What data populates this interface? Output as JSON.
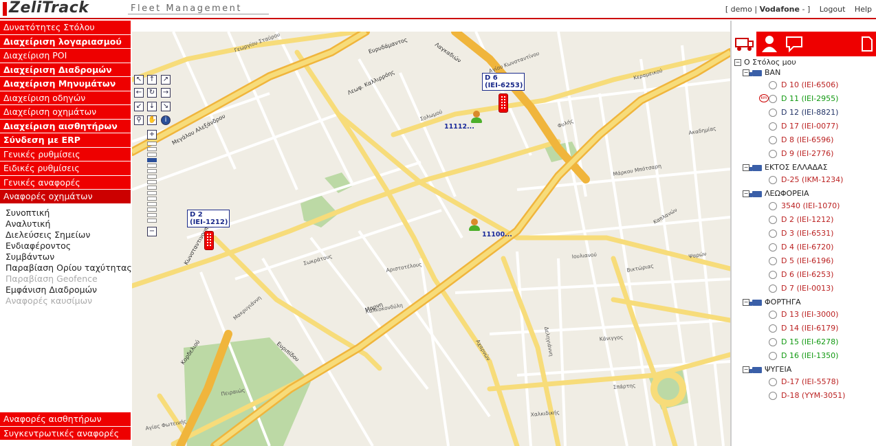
{
  "header": {
    "logo": "ZeliTrack",
    "subtitle": "Fleet Management",
    "user_box": "[ demo | Vodafone - ]",
    "user_name": "demo",
    "company": "Vodafone",
    "logout": "Logout",
    "help": "Help"
  },
  "menu": {
    "items": [
      "Δυνατότητες Στόλου",
      "Διαχείριση λογαριασμού",
      "Διαχείριση POI",
      "Διαχείριση Διαδρομών",
      "Διαχείριση Μηνυμάτων",
      "Διαχείριση οδηγών",
      "Διαχείριση οχημάτων",
      "Διαχείριση αισθητήρων",
      "Σύνδεση με ERP",
      "Γενικές ρυθμίσεις",
      "Ειδικές ρυθμίσεις",
      "Γενικές αναφορές",
      "Αναφορές οχημάτων"
    ],
    "submenu": [
      "Συνοπτική",
      "Αναλυτική",
      "Διελεύσεις Σημείων",
      "Ενδιαφέροντος",
      "Συμβάντων",
      "Παραβίαση Ορίου ταχύτητας",
      "Παραβίαση Geofence",
      "Εμφάνιση Διαδρομών",
      "Αναφορές καυσίμων"
    ],
    "bottom": [
      "Αναφορές αισθητήρων",
      "Συγκεντρωτικές αναφορές"
    ]
  },
  "map": {
    "vehicle_labels": [
      {
        "text": "D 6 (ΙΕΙ-6253)"
      },
      {
        "text": "D 2 (ΙΕΙ-1212)"
      }
    ],
    "count_labels": [
      "11112...",
      "11100..."
    ],
    "streets": {
      "s1": "Λεωφ. Καλλιρρόης",
      "s2": "Λαγκαδιών",
      "s3": "Ευρυδάμαντος",
      "s4": "Μεγάλου Αλεξάνδρου",
      "s5": "Κωνσταντινουπόλεως",
      "s6": "Ευριπίδου",
      "s7": "Κορδελιού",
      "s8": "Μακρυγιάννη",
      "s9": "Αριστοτέλους",
      "s10": "Φυλής",
      "s11": "Μαρνη",
      "s12": "Χαλκοκονδύλη",
      "s13": "Σωκράτους",
      "s14": "Πειραιώς",
      "s15": "Αγίας Φωτεινής",
      "s16": "Σολωμού",
      "s17": "Γεωργίου Σταύρου",
      "s18": "Αχαρνών",
      "s19": "Δεληγιάννη",
      "s20": "Αγίου Κωνσταντίνου",
      "s21": "Ιουλιανού",
      "s22": "Κάνιγγος",
      "s23": "Βικτώριας",
      "s24": "Καπλανών",
      "s25": "Μάρκου Μπότσαρη",
      "s26": "Κεραμεικού",
      "s27": "Ψαρών",
      "s28": "Σπάρτης",
      "s29": "Χαλκιδικής",
      "s30": "Ακαδημίας"
    }
  },
  "tree": {
    "root": "Ο Στόλος μου",
    "groups": [
      {
        "name": "ΒΑΝ",
        "vehicles": [
          {
            "label": "D 10 (ΙΕΙ-6506)",
            "color": "#b22"
          },
          {
            "label": "D 11 (ΙΕΙ-2955)",
            "color": "#191",
            "badge": "km"
          },
          {
            "label": "D 12 (ΙΕΙ-8821)",
            "color": "#236"
          },
          {
            "label": "D 17 (ΙΕΙ-0077)",
            "color": "#b22"
          },
          {
            "label": "D 8 (ΙΕΙ-6596)",
            "color": "#b22"
          },
          {
            "label": "D 9 (ΙΕΙ-2776)",
            "color": "#b22"
          }
        ]
      },
      {
        "name": "ΕΚΤΟΣ ΕΛΛΑΔΑΣ",
        "vehicles": [
          {
            "label": "D-25 (ΙΚΜ-1234)",
            "color": "#b22"
          }
        ]
      },
      {
        "name": "ΛΕΩΦΟΡΕΙΑ",
        "vehicles": [
          {
            "label": "3540 (ΙΕΙ-1070)",
            "color": "#b22"
          },
          {
            "label": "D 2 (ΙΕΙ-1212)",
            "color": "#b22"
          },
          {
            "label": "D 3 (ΙΕΙ-6531)",
            "color": "#b22"
          },
          {
            "label": "D 4 (ΙΕΙ-6720)",
            "color": "#b22"
          },
          {
            "label": "D 5 (ΙΕΙ-6196)",
            "color": "#b22"
          },
          {
            "label": "D 6 (ΙΕΙ-6253)",
            "color": "#b22"
          },
          {
            "label": "D 7 (ΙΕΙ-0013)",
            "color": "#b22"
          }
        ]
      },
      {
        "name": "ΦΟΡΤΗΓΑ",
        "vehicles": [
          {
            "label": "D 13 (ΙΕΙ-3000)",
            "color": "#b22"
          },
          {
            "label": "D 14 (ΙΕΙ-6179)",
            "color": "#b22"
          },
          {
            "label": "D 15 (ΙΕΙ-6278)",
            "color": "#191"
          },
          {
            "label": "D 16 (ΙΕΙ-1350)",
            "color": "#191"
          }
        ]
      },
      {
        "name": "ΨΥΓΕΙΑ",
        "vehicles": [
          {
            "label": "D-17 (ΙΕΙ-5578)",
            "color": "#b22"
          },
          {
            "label": "D-18 (ΥΥΜ-3051)",
            "color": "#b22"
          }
        ]
      }
    ]
  },
  "colors": {
    "accent": "#e00000",
    "map_bg": "#f0ede4",
    "main_road": "#f0b53c",
    "secondary_road": "#f7dc7a",
    "park": "#bcd9a5"
  }
}
